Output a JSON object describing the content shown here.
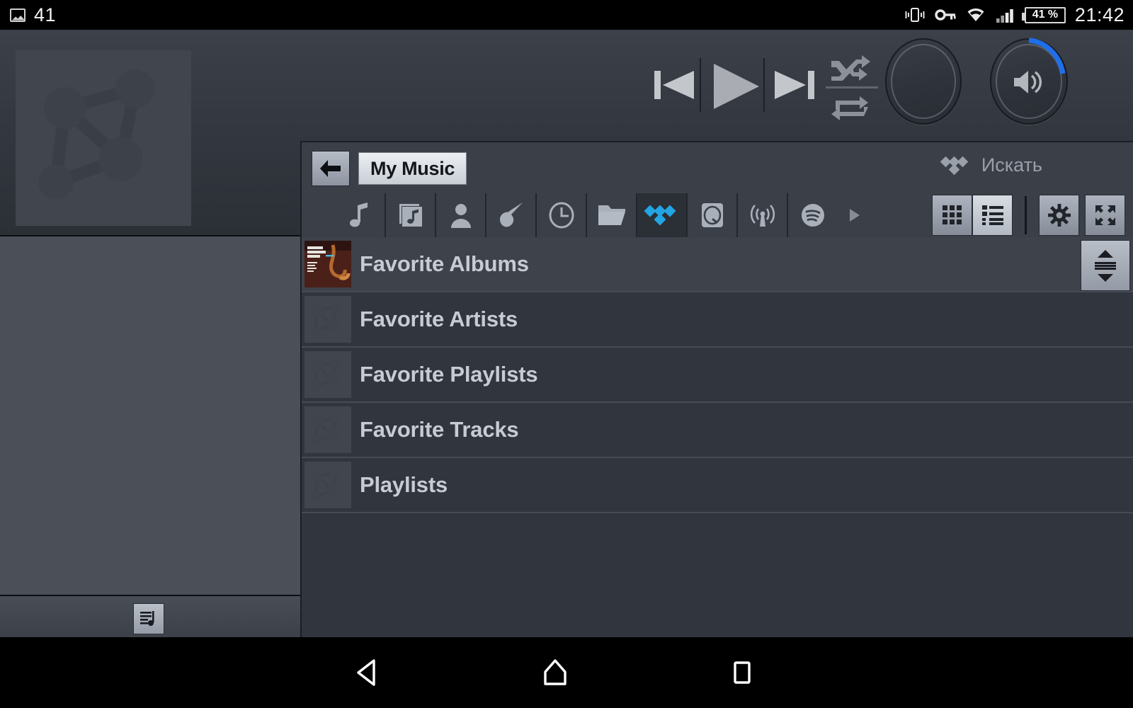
{
  "status_bar": {
    "notification_count": "41",
    "battery": "41 %",
    "time": "21:42",
    "icons": [
      "image-icon",
      "vibrate-icon",
      "key-icon",
      "wifi-icon",
      "signal-icon",
      "battery-icon"
    ]
  },
  "player": {
    "album_art_placeholder": "node-graph-icon",
    "controls": {
      "previous": "previous-track",
      "play": "play",
      "next": "next-track",
      "shuffle": "shuffle",
      "repeat": "repeat"
    },
    "knobs": {
      "balance_label": "",
      "volume_label": "",
      "volume_percent": 28,
      "volume_arc_color": "#1f6fe8"
    }
  },
  "browser": {
    "back_button": "back-icon",
    "breadcrumb": "My Music",
    "search": {
      "label": "Искать",
      "icon": "tidal-icon"
    },
    "source_tabs": [
      {
        "name": "tab-tracks",
        "icon": "music-note-icon",
        "active": false
      },
      {
        "name": "tab-albums",
        "icon": "album-icon",
        "active": false
      },
      {
        "name": "tab-artists",
        "icon": "person-icon",
        "active": false
      },
      {
        "name": "tab-genres",
        "icon": "guitar-icon",
        "active": false
      },
      {
        "name": "tab-recent",
        "icon": "clock-icon",
        "active": false
      },
      {
        "name": "tab-folders",
        "icon": "folder-icon",
        "active": false
      },
      {
        "name": "tab-tidal",
        "icon": "tidal-icon",
        "active": true
      },
      {
        "name": "tab-qobuz",
        "icon": "disc-icon",
        "active": false
      },
      {
        "name": "tab-radio",
        "icon": "radio-waves-icon",
        "active": false
      },
      {
        "name": "tab-spotify",
        "icon": "spotify-icon",
        "active": false
      },
      {
        "name": "tab-more",
        "icon": "play-arrow-icon",
        "active": false
      }
    ],
    "view_toggle": [
      {
        "name": "grid-view-button",
        "icon": "grid-icon",
        "active": false
      },
      {
        "name": "list-view-button",
        "icon": "list-icon",
        "active": true
      }
    ],
    "settings_button": "gear-icon",
    "fullscreen_button": "fullscreen-icon",
    "rows": [
      {
        "label": "Favorite Albums",
        "thumb": "album-cover",
        "selected": true
      },
      {
        "label": "Favorite Artists",
        "thumb": "node-graph-icon",
        "selected": false
      },
      {
        "label": "Favorite Playlists",
        "thumb": "node-graph-icon",
        "selected": false
      },
      {
        "label": "Favorite Tracks",
        "thumb": "node-graph-icon",
        "selected": false
      },
      {
        "label": "Playlists",
        "thumb": "node-graph-icon",
        "selected": false
      }
    ],
    "scrollbar": "vertical-scrollbar"
  },
  "left_panel": {
    "queue_button": "playlist-icon"
  },
  "nav_bar": {
    "back": "back-triangle-icon",
    "home": "home-icon",
    "recents": "recents-square-icon"
  },
  "colors": {
    "accent_blue": "#20a0e8",
    "volume_blue": "#1f6fe8",
    "panel_bg": "#3a3f48",
    "list_bg": "#31353d",
    "text": "#c6cbd4"
  }
}
